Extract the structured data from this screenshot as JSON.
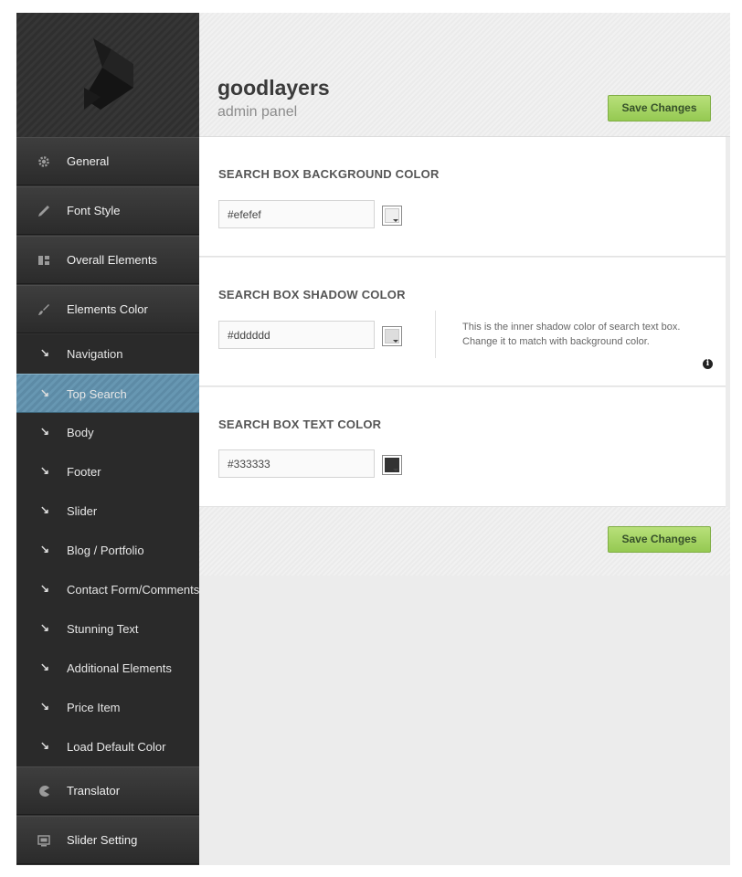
{
  "brand": {
    "title": "goodlayers",
    "subtitle": "admin panel"
  },
  "save_label": "Save Changes",
  "sidebar": {
    "main_items": [
      {
        "label": "General",
        "icon": "gear-icon"
      },
      {
        "label": "Font Style",
        "icon": "pencil-icon"
      },
      {
        "label": "Overall Elements",
        "icon": "layout-icon"
      },
      {
        "label": "Elements Color",
        "icon": "brush-icon"
      }
    ],
    "sub_items": [
      "Navigation",
      "Top Search",
      "Body",
      "Footer",
      "Slider",
      "Blog / Portfolio",
      "Contact Form/Comments",
      "Stunning Text",
      "Additional Elements",
      "Price Item",
      "Load Default Color"
    ],
    "active_sub_item": "Top Search",
    "bottom_items": [
      {
        "label": "Translator",
        "icon": "pacman-icon"
      },
      {
        "label": "Slider Setting",
        "icon": "slides-icon"
      }
    ]
  },
  "sections": [
    {
      "title": "SEARCH BOX BACKGROUND COLOR",
      "value": "#efefef",
      "swatch_color": "#efefef"
    },
    {
      "title": "SEARCH BOX SHADOW COLOR",
      "value": "#dddddd",
      "swatch_color": "#dddddd",
      "description": "This is the inner shadow color of search text box. Change it to match with background color."
    },
    {
      "title": "SEARCH BOX TEXT COLOR",
      "value": "#333333",
      "swatch_color": "#333333"
    }
  ],
  "colors": {
    "accent_button": "#a6d466",
    "active_nav": "#6393ae",
    "sidebar": "#333333"
  }
}
